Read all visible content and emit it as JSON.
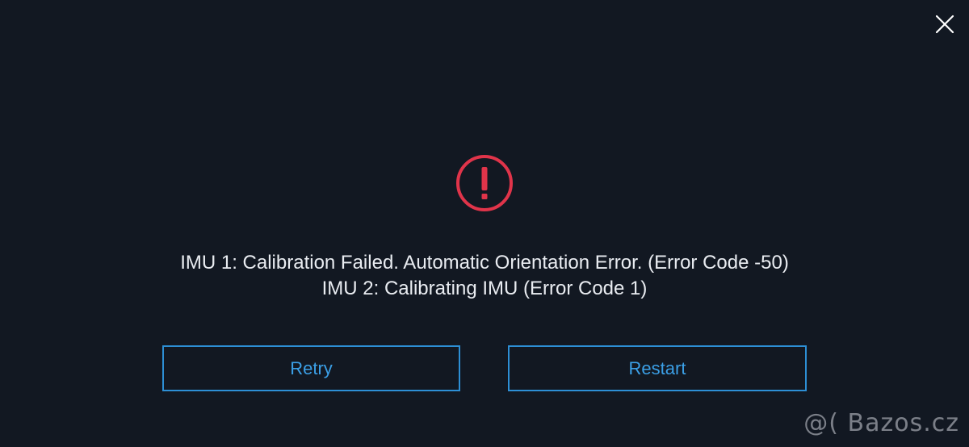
{
  "dialog": {
    "close_icon": "close-icon",
    "alert_icon": "exclamation-circle-icon",
    "alert_color": "#e0344a",
    "messages": [
      "IMU 1: Calibration Failed. Automatic Orientation Error. (Error Code -50)",
      "IMU 2: Calibrating IMU (Error Code 1)"
    ],
    "buttons": {
      "retry_label": "Retry",
      "restart_label": "Restart"
    },
    "accent_color": "#2d8fd5"
  },
  "watermark": {
    "text": "@( Bazos.cz"
  }
}
